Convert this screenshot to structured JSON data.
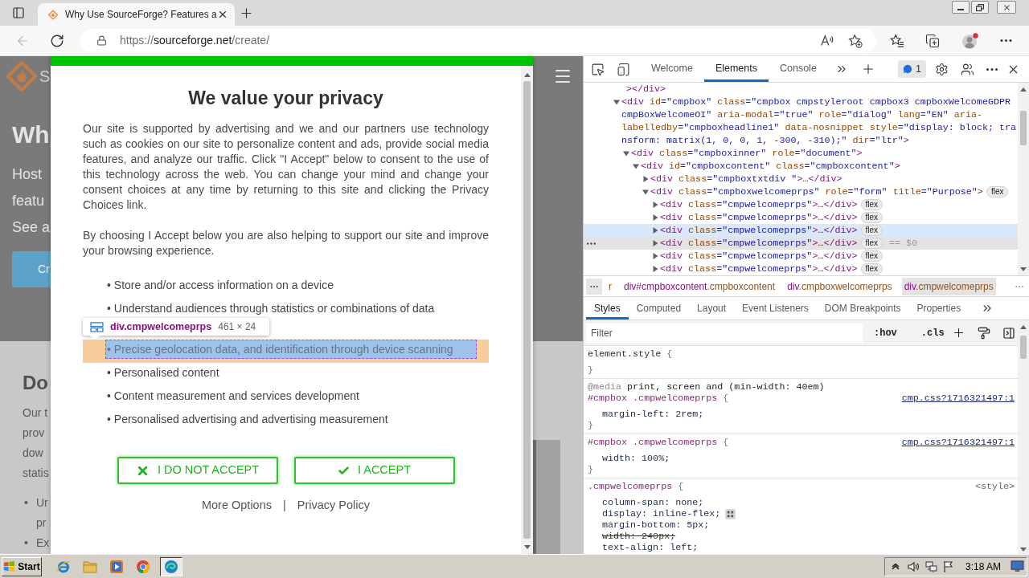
{
  "browser": {
    "tab": {
      "title": "Why Use SourceForge? Features a"
    },
    "back_button": {
      "disabled": true
    },
    "url": {
      "scheme": "https://",
      "host": "sourceforge.net",
      "path": "/create/"
    }
  },
  "page": {
    "logo_text": "S",
    "heading": "Wh",
    "intro_lines": [
      "Host",
      "featu",
      "See a"
    ],
    "button": "Cr",
    "section_heading": "Do",
    "section_lines": [
      "Our t",
      "prov",
      "dow",
      "statis"
    ],
    "bullets": [
      {
        "marker": "•",
        "lines": [
          "Ur",
          "pr"
        ]
      },
      {
        "marker": "•",
        "lines": [
          "Ex"
        ]
      }
    ]
  },
  "consent_dialog": {
    "title": "We value your privacy",
    "paragraphs": [
      "Our site is supported by advertising and we and our partners use technology such as cookies on our site to personalize content and ads, provide social media features, and analyze our traffic. Click \"I Accept\" below to consent to the use of this technology across the web. You can change your mind and change your consent choices at any time by returning to this site and clicking the Privacy Choices link.",
      "By choosing I Accept below you are also helping to support our site and improve your browsing experience."
    ],
    "purposes": [
      {
        "text": "• Store and/or access information on a device",
        "highlighted": false
      },
      {
        "text": "• Understand audiences through statistics or combinations of data",
        "highlighted": false
      },
      {
        "text": "• Precise geolocation data, and identification through device scanning",
        "highlighted": true
      },
      {
        "text": "• Personalised content",
        "highlighted": false
      },
      {
        "text": "• Content measurement and services development",
        "highlighted": false
      },
      {
        "text": "• Personalised advertising and advertising measurement",
        "highlighted": false
      }
    ],
    "inspect_tooltip": {
      "selector": "div.cmpwelcomeprps",
      "size": "461 × 24"
    },
    "buttons": [
      {
        "label": "I DO NOT ACCEPT",
        "kind": "reject"
      },
      {
        "label": "I ACCEPT",
        "kind": "accept"
      }
    ],
    "links": [
      "More Options",
      "Privacy Policy"
    ],
    "separator": "|"
  },
  "devtools": {
    "tabs": [
      {
        "label": "Welcome",
        "selected": false
      },
      {
        "label": "Elements",
        "selected": true
      },
      {
        "label": "Console",
        "selected": false
      }
    ],
    "issues_count": "1",
    "dom_tree": [
      {
        "kind": "fragment",
        "text": "></div>"
      },
      {
        "kind": "element",
        "tag": "<div",
        "attrs": [
          {
            "name": "id",
            "value": "=\"cmpbox\""
          },
          {
            "name": "class",
            "value": "=\"cmpbox cmpstyleroot cmpbox3 cmpboxWelcomeGDPR cmpBoxWelcomeOI\""
          },
          {
            "name": "aria-modal",
            "value": "=\"true\""
          },
          {
            "name": "role",
            "value": "=\"dialog\""
          },
          {
            "name": "lang",
            "value": "=\"EN\""
          },
          {
            "name": "aria-labelledby",
            "value": "=\"cmpboxheadline1\""
          },
          {
            "name": "data-nosnippet"
          },
          {
            "name": "style",
            "value": "=\"display: block; transform: matrix(1, 0, 0, 1, -300, -310);\""
          },
          {
            "name": "dir",
            "value": "=\"ltr\""
          }
        ],
        "end": ">",
        "expanded": true,
        "hovered": false,
        "selected": false,
        "children": [
          {
            "kind": "element",
            "tag": "<div",
            "attrs": [
              {
                "name": "class",
                "value": "=\"cmpboxinner\""
              },
              {
                "name": "role",
                "value": "=\"document\""
              }
            ],
            "end": ">",
            "expanded": true,
            "hovered": false,
            "selected": false,
            "children": [
              {
                "kind": "element",
                "tag": "<div",
                "attrs": [
                  {
                    "name": "id",
                    "value": "=\"cmpboxcontent\""
                  },
                  {
                    "name": "class",
                    "value": "=\"cmpboxcontent\""
                  }
                ],
                "end": ">",
                "expanded": true,
                "hovered": false,
                "selected": false,
                "children": [
                  {
                    "kind": "element",
                    "tag": "<div",
                    "attrs": [
                      {
                        "name": "class",
                        "value": "=\"cmpboxtxtdiv \""
                      }
                    ],
                    "end": ">",
                    "collapsed_text": "…",
                    "close_tag": "</div>",
                    "expanded": false,
                    "hovered": false,
                    "selected": false
                  },
                  {
                    "kind": "element",
                    "tag": "<div",
                    "attrs": [
                      {
                        "name": "class",
                        "value": "=\"cmpboxwelcomeprps\""
                      },
                      {
                        "name": "role",
                        "value": "=\"form\""
                      },
                      {
                        "name": "title",
                        "value": "=\"Purpose\""
                      }
                    ],
                    "end": ">",
                    "badge": "flex",
                    "expanded": true,
                    "hovered": false,
                    "selected": false,
                    "children": [
                      {
                        "kind": "element",
                        "tag": "<div",
                        "attrs": [
                          {
                            "name": "class",
                            "value": "=\"cmpwelcomeprps\""
                          }
                        ],
                        "end": ">",
                        "collapsed_text": "…",
                        "close_tag": "</div>",
                        "badge": "flex",
                        "expanded": false,
                        "hovered": false,
                        "selected": false
                      },
                      {
                        "kind": "element",
                        "tag": "<div",
                        "attrs": [
                          {
                            "name": "class",
                            "value": "=\"cmpwelcomeprps\""
                          }
                        ],
                        "end": ">",
                        "collapsed_text": "…",
                        "close_tag": "</div>",
                        "badge": "flex",
                        "expanded": false,
                        "hovered": false,
                        "selected": false
                      },
                      {
                        "kind": "element",
                        "tag": "<div",
                        "attrs": [
                          {
                            "name": "class",
                            "value": "=\"cmpwelcomeprps\""
                          }
                        ],
                        "end": ">",
                        "collapsed_text": "…",
                        "close_tag": "</div>",
                        "badge": "flex",
                        "expanded": false,
                        "hovered": true,
                        "selected": false
                      },
                      {
                        "kind": "element",
                        "tag": "<div",
                        "attrs": [
                          {
                            "name": "class",
                            "value": "=\"cmpwelcomeprps\""
                          }
                        ],
                        "end": ">",
                        "collapsed_text": "…",
                        "close_tag": "</div>",
                        "badge": "flex",
                        "expanded": false,
                        "hovered": false,
                        "selected": true,
                        "console_ref": "== $0"
                      },
                      {
                        "kind": "element",
                        "tag": "<div",
                        "attrs": [
                          {
                            "name": "class",
                            "value": "=\"cmpwelcomeprps\""
                          }
                        ],
                        "end": ">",
                        "collapsed_text": "…",
                        "close_tag": "</div>",
                        "badge": "flex",
                        "expanded": false,
                        "hovered": false,
                        "selected": false
                      },
                      {
                        "kind": "element",
                        "tag": "<div",
                        "attrs": [
                          {
                            "name": "class",
                            "value": "=\"cmpwelcomeprps\""
                          }
                        ],
                        "end": ">",
                        "collapsed_text": "…",
                        "close_tag": "</div>",
                        "badge": "flex",
                        "expanded": false,
                        "hovered": false,
                        "selected": false
                      }
                    ]
                  }
                ]
              }
            ]
          }
        ]
      }
    ],
    "breadcrumbs": [
      {
        "classes": "r",
        "selected": false
      },
      {
        "tag": "div#cmpboxcontent",
        "classes": ".cmpboxcontent",
        "selected": false
      },
      {
        "tag": "div",
        "classes": ".cmpboxwelcomeprps",
        "selected": false
      },
      {
        "tag": "div",
        "classes": ".cmpwelcomeprps",
        "selected": true
      }
    ],
    "sidebar_tabs": [
      {
        "label": "Styles",
        "selected": true
      },
      {
        "label": "Computed",
        "selected": false
      },
      {
        "label": "Layout",
        "selected": false
      },
      {
        "label": "Event Listeners",
        "selected": false
      },
      {
        "label": "DOM Breakpoints",
        "selected": false
      },
      {
        "label": "Properties",
        "selected": false
      }
    ],
    "filter": {
      "placeholder": "Filter"
    },
    "filter_toggles": [
      ":hov",
      ".cls"
    ],
    "rules": [
      {
        "kind": "element",
        "selector": "element.style",
        "open": "{",
        "close": "}"
      },
      {
        "kind": "rule",
        "media": {
          "keyword": "@media",
          "query": "print, screen and (min-width: 40em)"
        },
        "selector": "#cmpbox .cmpwelcomeprps",
        "open": "{",
        "source": {
          "kind": "link",
          "text": "cmp.css?1716321497:1"
        },
        "declarations": [
          {
            "text": "margin-left: 2rem;",
            "overridden": false,
            "editor_icon": false
          }
        ],
        "close": "}"
      },
      {
        "kind": "rule",
        "selector": "#cmpbox .cmpwelcomeprps",
        "open": "{",
        "source": {
          "kind": "link",
          "text": "cmp.css?1716321497:1"
        },
        "declarations": [
          {
            "text": "width: 100%;",
            "overridden": false,
            "editor_icon": false
          }
        ],
        "close": "}"
      },
      {
        "kind": "rule",
        "selector": ".cmpwelcomeprps",
        "open": "{",
        "source": {
          "kind": "style",
          "text": "<style>"
        },
        "declarations": [
          {
            "text": "column-span: none;",
            "overridden": false,
            "editor_icon": false
          },
          {
            "text": "display: inline-flex;",
            "overridden": false,
            "editor_icon": true
          },
          {
            "text": "margin-bottom: 5px;",
            "overridden": false,
            "editor_icon": false
          },
          {
            "text": "width: 240px;",
            "overridden": true,
            "editor_icon": false
          },
          {
            "text": "text-align: left;",
            "overridden": false,
            "editor_icon": false
          }
        ]
      }
    ]
  },
  "taskbar": {
    "start": "Start",
    "quick_launch": [
      {
        "kind": "ie",
        "pressed": false
      },
      {
        "kind": "folder",
        "pressed": false
      },
      {
        "kind": "media",
        "pressed": false
      },
      {
        "kind": "chrome",
        "pressed": false
      },
      {
        "kind": "edge",
        "pressed": true
      }
    ],
    "clock": "3:18 AM"
  }
}
